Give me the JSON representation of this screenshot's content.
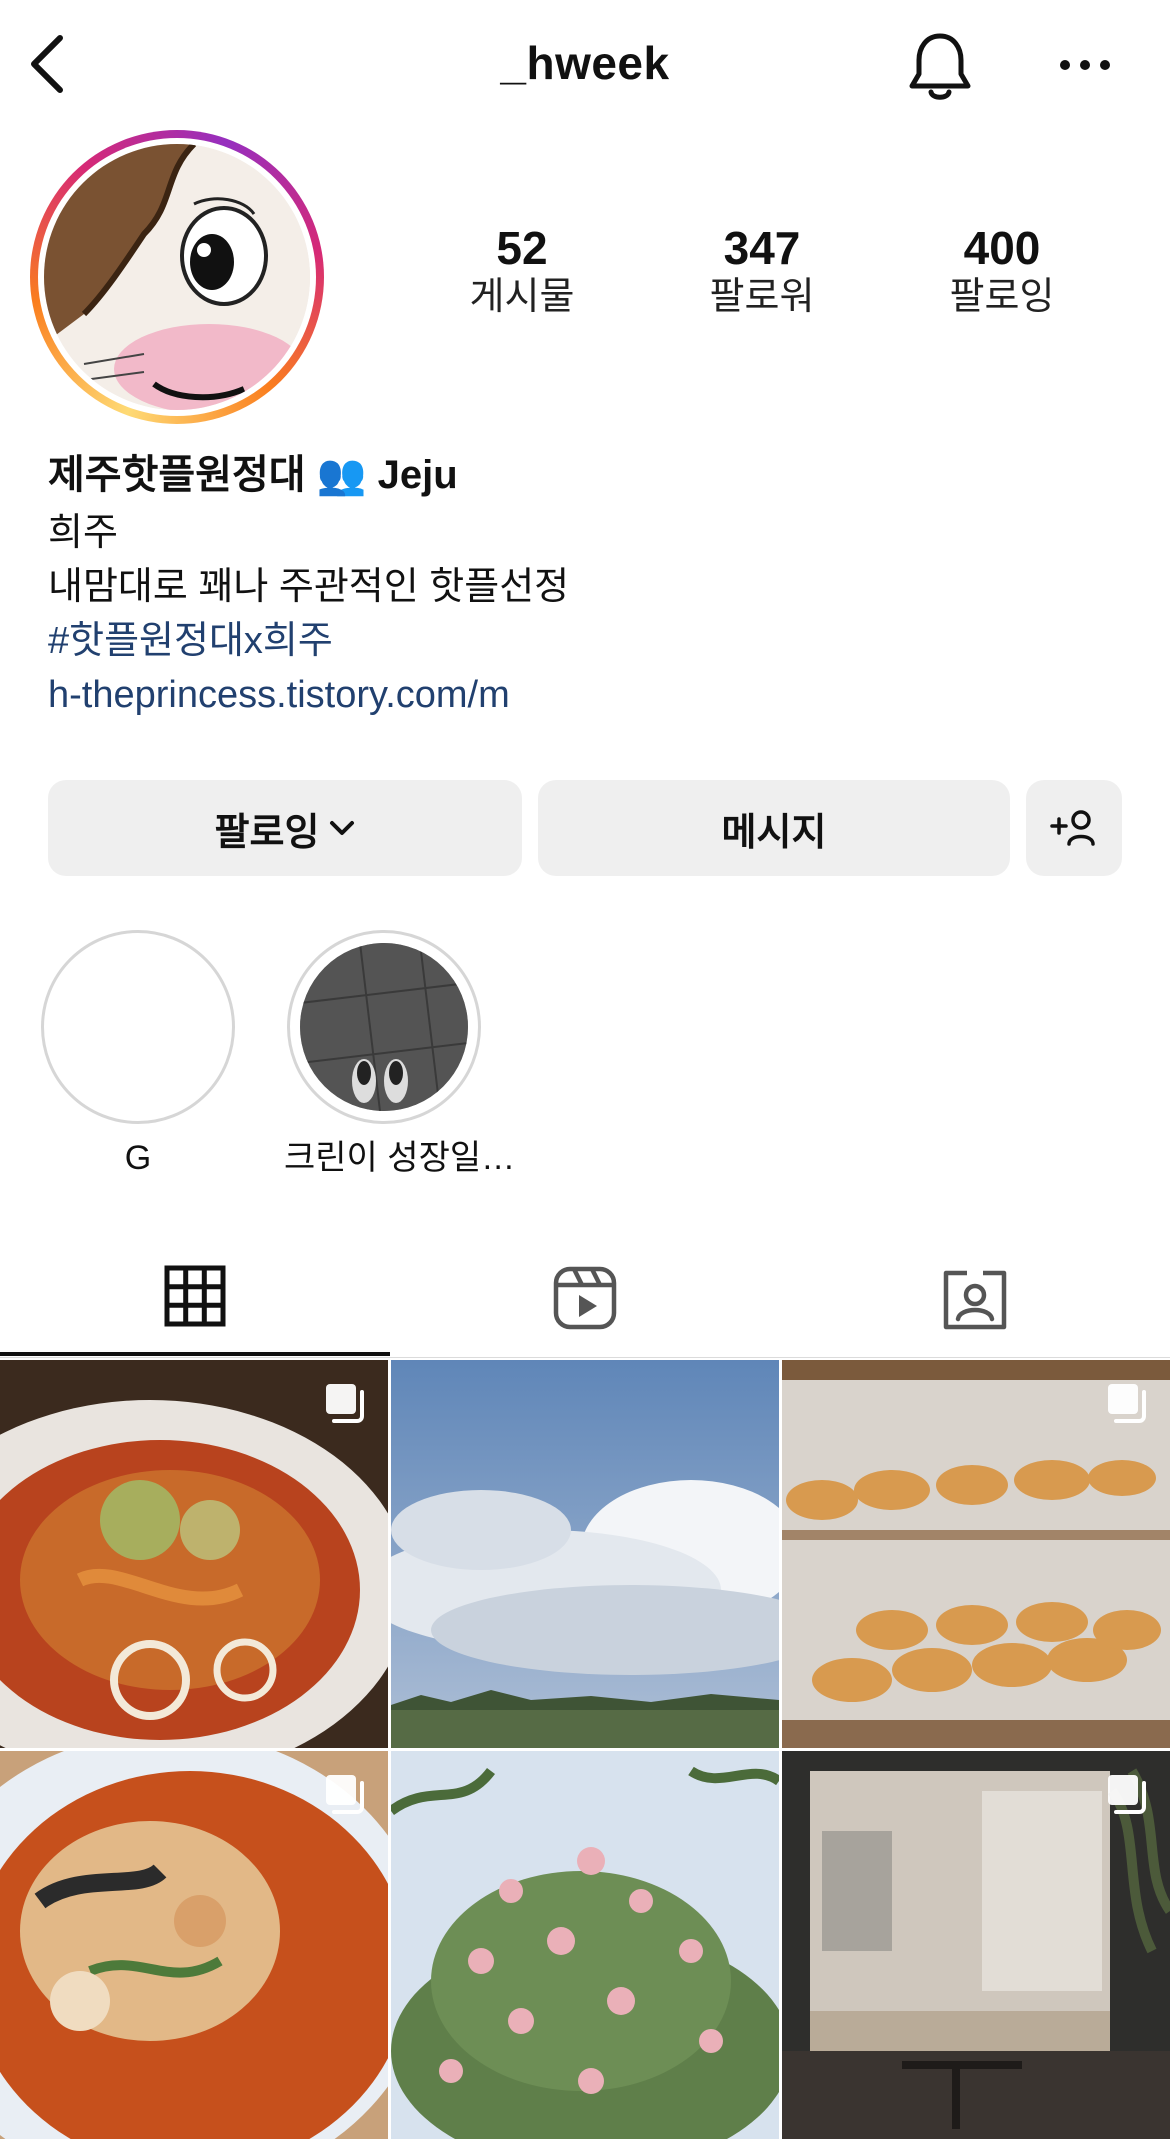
{
  "header": {
    "username": "_hweek"
  },
  "stats": [
    {
      "value": "52",
      "label": "게시물"
    },
    {
      "value": "347",
      "label": "팔로워"
    },
    {
      "value": "400",
      "label": "팔로잉"
    }
  ],
  "bio": {
    "name": "제주핫플원정대 👥 Jeju",
    "line1": "희주",
    "line2": "내맘대로 꽤나 주관적인 핫플선정",
    "hashtag": "#핫플원정대x희주",
    "website": "h-theprincess.tistory.com/m"
  },
  "buttons": {
    "following": "팔로잉",
    "message": "메시지"
  },
  "highlights": [
    {
      "label": "G"
    },
    {
      "label": "크린이 성장일…"
    }
  ],
  "tabs": [
    "grid-icon",
    "reels-icon",
    "tagged-icon"
  ],
  "colors": {
    "link": "#21406f",
    "button_bg": "#efefef",
    "ring_start": "#feda75",
    "ring_end": "#962fbf"
  }
}
